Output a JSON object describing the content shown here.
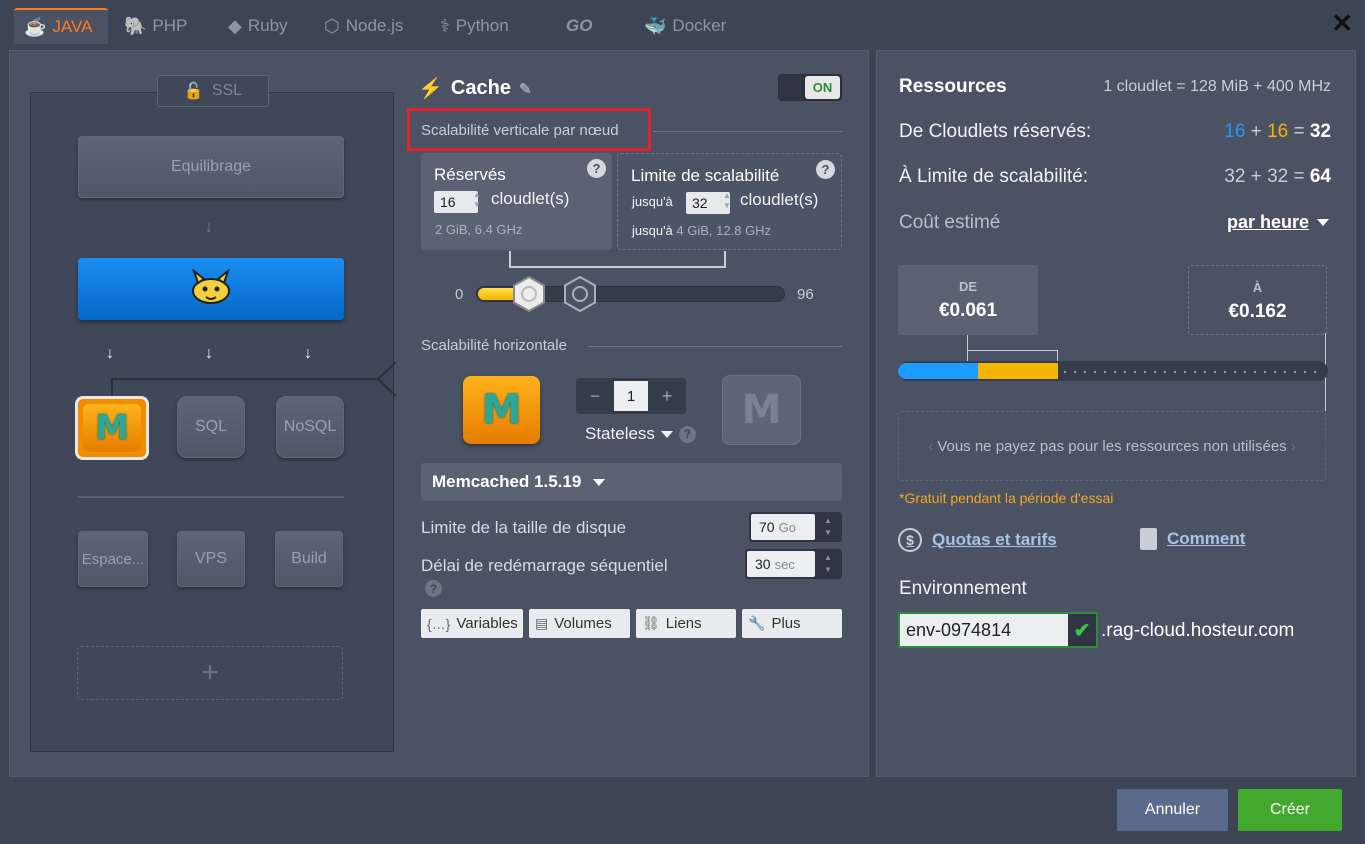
{
  "tabs": [
    {
      "label": "JAVA",
      "icon": "java-icon",
      "active": true
    },
    {
      "label": "PHP",
      "icon": "php-icon",
      "active": false
    },
    {
      "label": "Ruby",
      "icon": "ruby-icon",
      "active": false
    },
    {
      "label": "Node.js",
      "icon": "nodejs-icon",
      "active": false
    },
    {
      "label": "Python",
      "icon": "python-icon",
      "active": false
    },
    {
      "label": "GO",
      "icon": "go-icon",
      "active": false
    },
    {
      "label": "Docker",
      "icon": "docker-icon",
      "active": false
    }
  ],
  "topology": {
    "ssl_label": "SSL",
    "balancer_label": "Equilibrage",
    "sql_label": "SQL",
    "nosql_label": "NoSQL",
    "storage_label": "Espace...",
    "vps_label": "VPS",
    "build_label": "Build",
    "add_symbol": "+"
  },
  "config": {
    "title": "Cache",
    "toggle_label": "ON",
    "vertical_section": "Scalabilité verticale par nœud",
    "reserved": {
      "title": "Réservés",
      "value": "16",
      "unit": "cloudlet(s)",
      "detail": "2 GiB, 6.4 GHz"
    },
    "limit": {
      "title": "Limite de scalabilité",
      "prefix": "jusqu'à",
      "value": "32",
      "unit": "cloudlet(s)",
      "detail_prefix": "jusqu'à",
      "detail": "4 GiB, 12.8 GHz"
    },
    "slider": {
      "min": "0",
      "max": "96",
      "reserved": 16,
      "limit": 32
    },
    "horizontal_section": "Scalabilité horizontale",
    "node_count": "1",
    "mode": "Stateless",
    "version": "Memcached 1.5.19",
    "disk_label": "Limite de la taille de disque",
    "disk_value": "70",
    "disk_unit": "Go",
    "restart_label": "Délai de redémarrage séquentiel",
    "restart_value": "30",
    "restart_unit": "sec",
    "buttons": {
      "variables": "Variables",
      "volumes": "Volumes",
      "links": "Liens",
      "more": "Plus"
    }
  },
  "resources": {
    "title": "Ressources",
    "note": "1 cloudlet = 128 MiB + 400 MHz",
    "reserved_label": "De Cloudlets réservés:",
    "reserved_a": "16",
    "reserved_b": "16",
    "reserved_total": "32",
    "limit_label": "À Limite de scalabilité:",
    "limit_a": "32",
    "limit_b": "32",
    "limit_total": "64",
    "cost_label": "Coût estimé",
    "period": "par heure",
    "from_key": "DE",
    "from_value": "€0.061",
    "to_key": "À",
    "to_value": "€0.162",
    "info": "Vous ne payez pas pour les ressources non utilisées",
    "trial": "*Gratuit pendant la période d'essai",
    "quotas_link": "Quotas et tarifs",
    "how_link": "Comment",
    "env_label": "Environnement",
    "env_value": "env-0974814",
    "env_domain": ".rag-cloud.hosteur.com"
  },
  "footer": {
    "cancel": "Annuler",
    "create": "Créer"
  },
  "colors": {
    "accent": "#ff7a1a",
    "primary_blue": "#1e9bff",
    "yellow": "#f5b400",
    "create_green": "#42a82e",
    "highlight_red": "#e4242c"
  }
}
